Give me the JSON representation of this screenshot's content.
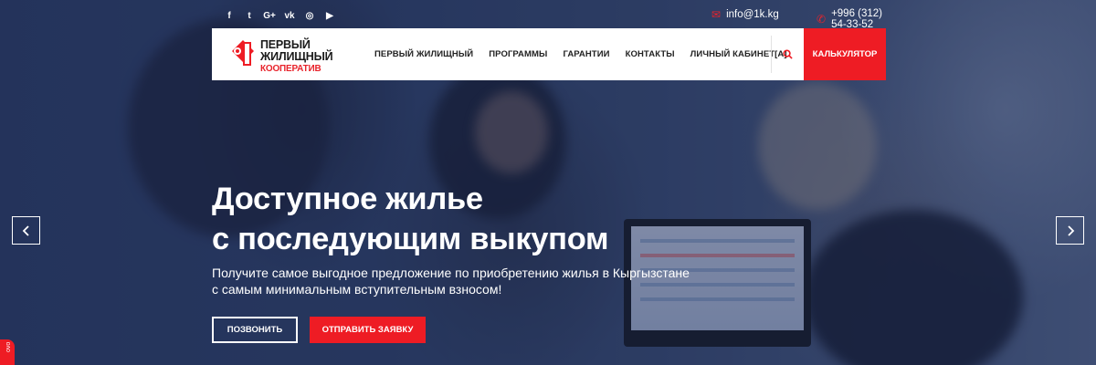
{
  "colors": {
    "accent": "#ee1c24",
    "overlay": "#1c2c58",
    "white": "#ffffff"
  },
  "topbar": {
    "socials": [
      {
        "icon": "facebook-icon",
        "glyph": "f"
      },
      {
        "icon": "twitter-icon",
        "glyph": "t"
      },
      {
        "icon": "google-plus-icon",
        "glyph": "G+"
      },
      {
        "icon": "vk-icon",
        "glyph": "vk"
      },
      {
        "icon": "instagram-icon",
        "glyph": "◎"
      },
      {
        "icon": "youtube-icon",
        "glyph": "▶"
      }
    ],
    "email": "info@1k.kg",
    "phone": "+996 (312) 54-33-52"
  },
  "logo": {
    "line1": "ПЕРВЫЙ",
    "line2": "ЖИЛИЩНЫЙ",
    "line3": "КООПЕРАТИВ"
  },
  "menu": [
    "ПЕРВЫЙ ЖИЛИЩНЫЙ",
    "ПРОГРАММЫ",
    "ГАРАНТИИ",
    "КОНТАКТЫ",
    "ЛИЧНЫЙ КАБИНЕТ[А]"
  ],
  "calc_button": "КАЛЬКУЛЯТОР",
  "hero": {
    "title_line1": "Доступное жилье",
    "title_line2": "с последующим выкупом",
    "subtitle_line1": "Получите самое выгодное предложение по приобретению жилья в Кыргызстане",
    "subtitle_line2": "с самым минимальным вступительным взносом!",
    "call_button": "ПОЗВОНИТЬ",
    "apply_button": "ОТПРАВИТЬ ЗАЯВКУ"
  },
  "side_tab": "ovo"
}
